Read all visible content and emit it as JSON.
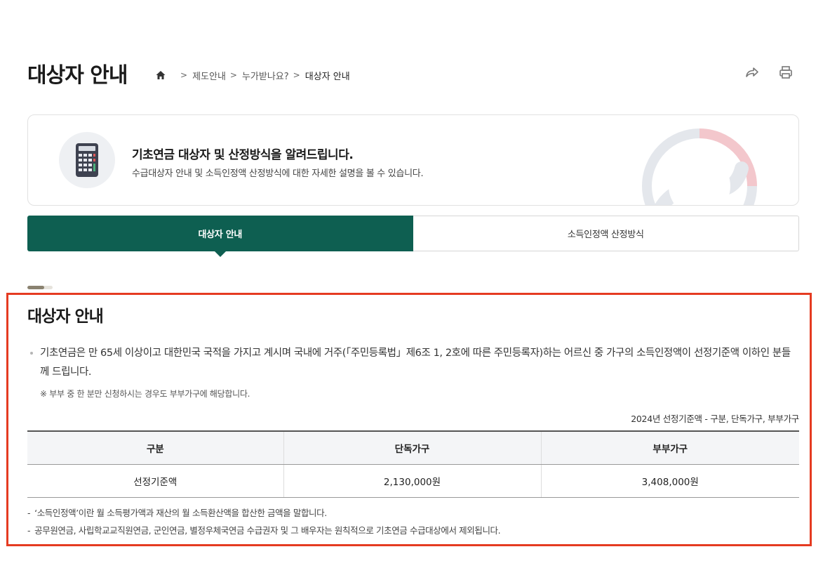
{
  "page": {
    "title": "대상자 안내"
  },
  "breadcrumb": {
    "items": [
      "제도안내",
      "누가받나요?",
      "대상자 안내"
    ]
  },
  "intro": {
    "heading": "기초연금 대상자 및 산정방식을 알려드립니다.",
    "description": "수급대상자 안내 및 소득인정액 산정방식에 대한 자세한 설명을 볼 수 있습니다."
  },
  "tabs": [
    {
      "label": "대상자 안내",
      "active": true
    },
    {
      "label": "소득인정액 산정방식",
      "active": false
    }
  ],
  "progress": {
    "fraction": 0.67
  },
  "section": {
    "title": "대상자 안내",
    "bullet": "기초연금은 만 65세 이상이고 대한민국 국적을 가지고 계시며 국내에 거주(「주민등록법」제6조 1, 2호에 따른 주민등록자)하는 어르신 중 가구의 소득인정액이 선정기준액 이하인 분들께 드립니다.",
    "note": "※ 부부 중 한 분만 신청하시는 경우도 부부가구에 해당합니다.",
    "table_caption": "2024년 선정기준액 - 구분, 단독가구, 부부가구"
  },
  "table": {
    "headers": [
      "구분",
      "단독가구",
      "부부가구"
    ],
    "rows": [
      [
        "선정기준액",
        "2,130,000원",
        "3,408,000원"
      ]
    ]
  },
  "footnotes": [
    "‘소득인정액’이란 월 소득평가액과 재산의 월 소득환산액을 합산한 금액을 말합니다.",
    "공무원연금, 사립학교교직원연금, 군인연금, 별정우체국연금 수급권자 및 그 배우자는 원칙적으로 기초연금 수급대상에서 제외됩니다."
  ],
  "colors": {
    "accent": "#0e5f51",
    "highlight": "#e53b21"
  }
}
